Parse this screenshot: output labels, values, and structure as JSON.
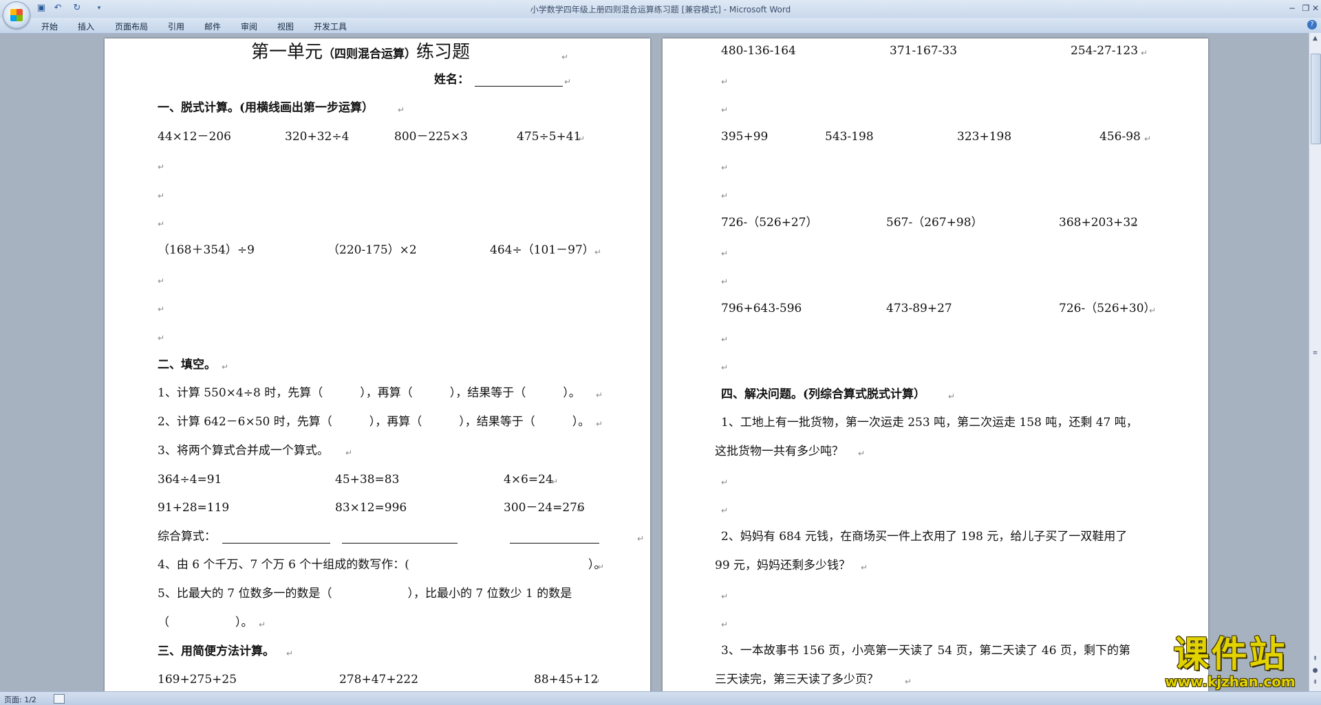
{
  "window": {
    "title": "小学数学四年级上册四则混合运算练习题 [兼容模式] - Microsoft Word"
  },
  "ribbon_tabs": [
    "开始",
    "插入",
    "页面布局",
    "引用",
    "邮件",
    "审阅",
    "视图",
    "开发工具"
  ],
  "status": {
    "page": "页面: 1/2"
  },
  "watermark": {
    "text": "课件站",
    "url": "www.kjzhan.com"
  },
  "page1": {
    "title_a": "第一单元",
    "title_b": "（四则混合运算）",
    "title_c": "练习题",
    "name_label": "姓名：",
    "sec1": "一、脱式计算。(用横线画出第一步运算）",
    "row1": [
      "44×12－206",
      "320+32÷4",
      "800－225×3",
      "475÷5+41"
    ],
    "row2": [
      "（168＋354）÷9",
      "（220-175）×2",
      "464÷（101－97）"
    ],
    "sec2": "二、填空。",
    "q1_a": "1、计算 550×4÷8 时，先算（",
    "q1_b": "），再算（",
    "q1_c": "），结果等于（",
    "q1_d": "）。",
    "q2_a": "2、计算 642－6×50 时，先算（",
    "q2_b": "），再算（",
    "q2_c": "），结果等于（",
    "q2_d": "）。",
    "q3": "3、将两个算式合并成一个算式。",
    "eq1": [
      "364÷4=91",
      "45+38=83",
      "4×6=24"
    ],
    "eq2": [
      "91+28=119",
      "83×12=996",
      "300－24=276"
    ],
    "combined": "综合算式：",
    "q4_a": "4、由 6 个千万、7 个万 6 个十组成的数写作：(",
    "q4_b": "）。",
    "q5_a": "5、比最大的 7 位数多一的数是（",
    "q5_b": "），比最小的 7 位数少 1 的数是",
    "q5_c": "（",
    "q5_d": "）。",
    "sec3": "三、用简便方法计算。",
    "row3": [
      "169+275+25",
      "278+47+222",
      "88+45+12"
    ]
  },
  "page2": {
    "row1": [
      "480-136-164",
      "371-167-33",
      "254-27-123"
    ],
    "row2": [
      "395+99",
      "543-198",
      "323+198",
      "456-98"
    ],
    "row3": [
      "726-（526+27）",
      "567-（267+98）",
      "368+203+32"
    ],
    "row4": [
      "796+643-596",
      "473-89+27",
      "726-（526+30）"
    ],
    "sec4": "四、解决问题。(列综合算式脱式计算）",
    "p1_a": "1、工地上有一批货物，第一次运走 253 吨，第二次运走 158 吨，还剩 47 吨，",
    "p1_b": "这批货物一共有多少吨？",
    "p2_a": "2、妈妈有 684 元钱，在商场买一件上衣用了 198 元，给儿子买了一双鞋用了",
    "p2_b": "99 元，妈妈还剩多少钱？",
    "p3_a": "3、一本故事书 156 页，小亮第一天读了 54 页，第二天读了 46 页，剩下的第",
    "p3_b": "三天读完，第三天读了多少页？"
  }
}
